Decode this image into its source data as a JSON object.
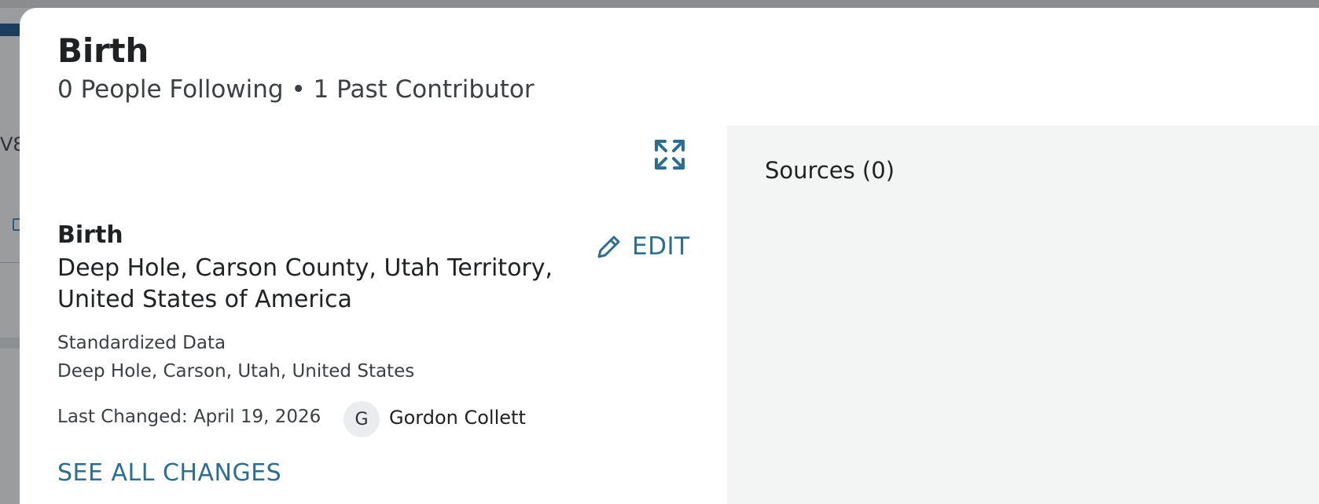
{
  "background": {
    "fragment_text": "V8"
  },
  "modal": {
    "title": "Birth",
    "subtitle": "0 People Following • 1 Past Contributor",
    "expand_icon": "expand-arrows-icon",
    "fact": {
      "label": "Birth",
      "value": "Deep Hole, Carson County, Utah Territory, United States of America",
      "standardized_label": "Standardized Data",
      "standardized_value": "Deep Hole, Carson, Utah, United States",
      "last_changed": "Last Changed: April 19, 2026",
      "contributor_initial": "G",
      "contributor_name": "Gordon Collett",
      "see_all_label": "SEE ALL CHANGES",
      "edit_label": "EDIT",
      "edit_icon": "pencil-icon"
    },
    "sources": {
      "title": "Sources (0)"
    }
  },
  "colors": {
    "accent": "#2c6e93",
    "panel_bg": "#f3f5f4",
    "overlay": "#9a9c9e"
  }
}
